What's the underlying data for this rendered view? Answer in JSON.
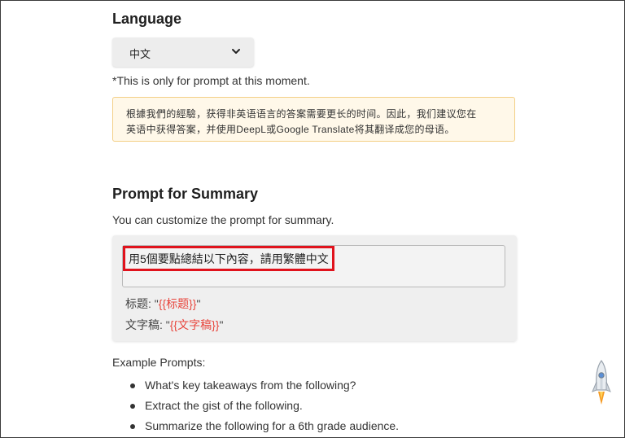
{
  "language": {
    "title": "Language",
    "selected": "中文",
    "note": "*This is only for prompt at this moment.",
    "warning_line1": "根據我們的經驗，获得非英语语言的答案需要更长的时间。因此，我们建议您在",
    "warning_line2": "英语中获得答案，并使用DeepL或Google Translate将其翻译成您的母语。"
  },
  "summary": {
    "title": "Prompt for Summary",
    "description": "You can customize the prompt for summary.",
    "prompt_value": "用5個要點總結以下內容，請用繁體中文",
    "var1_label": "标题: \"",
    "var1_token": "{{标题}}",
    "var1_end": "\"",
    "var2_label": "文字稿: \"",
    "var2_token": "{{文字稿}}",
    "var2_end": "\""
  },
  "examples": {
    "title": "Example Prompts:",
    "items": [
      "What's key takeaways from the following?",
      "Extract the gist of the following.",
      "Summarize the following for a 6th grade audience."
    ]
  },
  "colors": {
    "highlight_border": "#e0121c",
    "token": "#e8453c",
    "warning_bg": "#fff8e9",
    "warning_border": "#f3cf86"
  },
  "icons": [
    "chevron-down-icon",
    "rocket-icon"
  ]
}
